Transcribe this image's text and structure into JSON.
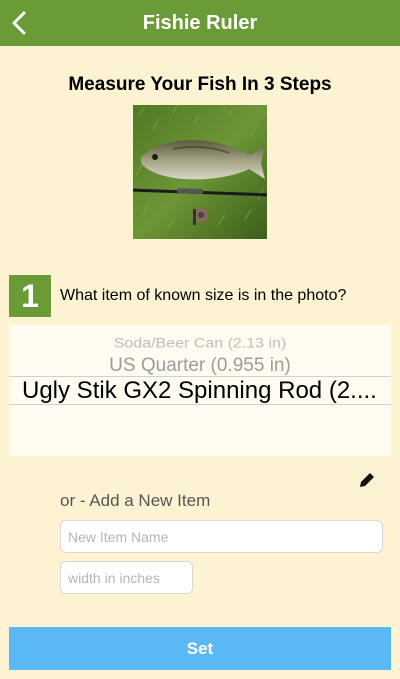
{
  "header": {
    "title": "Fishie Ruler",
    "back_icon": "chevron-left-icon",
    "color": "#6b9b37"
  },
  "main": {
    "heading": "Measure Your Fish In 3 Steps",
    "step": {
      "number": "1",
      "question": "What item of known size is in the photo?"
    },
    "picker": {
      "options": [
        "Soda/Beer Can (2.13 in)",
        "US Quarter (0.955 in)",
        "Ugly Stik GX2 Spinning Rod (2...."
      ],
      "selected_index": 2
    },
    "edit_icon": "pencil-icon",
    "add_item": {
      "label": "or - Add a New Item",
      "name_placeholder": "New Item Name",
      "width_placeholder": "width in inches"
    },
    "set_button": {
      "label": "Set",
      "color": "#5ab9f5"
    }
  }
}
